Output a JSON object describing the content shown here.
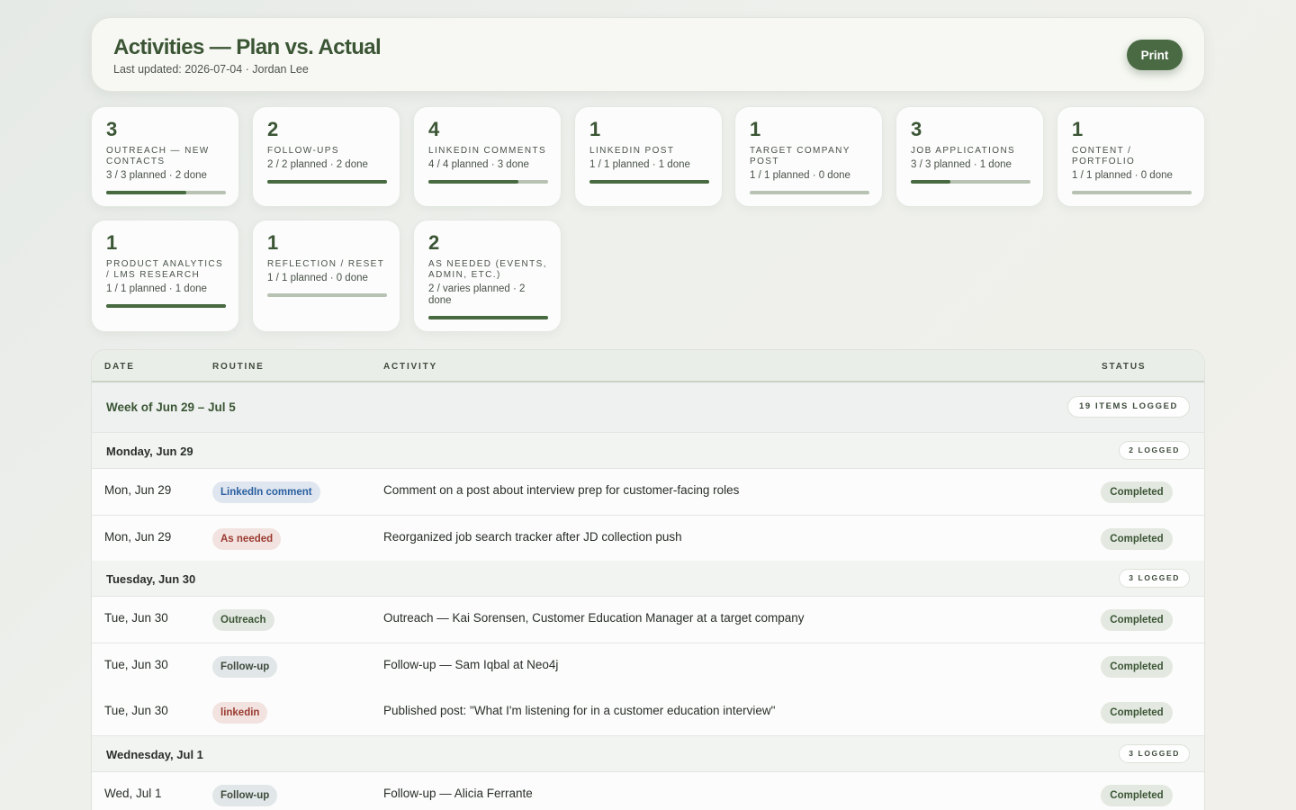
{
  "header": {
    "title": "Activities — Plan vs. Actual",
    "subtitle": "Last updated: 2026-07-04 · Jordan Lee",
    "print_label": "Print"
  },
  "cards": [
    {
      "count": "3",
      "label": "Outreach — new contacts",
      "meta": "3 / 3 planned · 2 done",
      "progress": 0.67
    },
    {
      "count": "2",
      "label": "Follow-ups",
      "meta": "2 / 2 planned · 2 done",
      "progress": 1.0
    },
    {
      "count": "4",
      "label": "LinkedIn comments",
      "meta": "4 / 4 planned · 3 done",
      "progress": 0.75
    },
    {
      "count": "1",
      "label": "LinkedIn post",
      "meta": "1 / 1 planned · 1 done",
      "progress": 1.0
    },
    {
      "count": "1",
      "label": "Target company post",
      "meta": "1 / 1 planned · 0 done",
      "progress": 0.0
    },
    {
      "count": "3",
      "label": "Job applications",
      "meta": "3 / 3 planned · 1 done",
      "progress": 0.33
    },
    {
      "count": "1",
      "label": "Content / portfolio",
      "meta": "1 / 1 planned · 0 done",
      "progress": 0.0
    },
    {
      "count": "1",
      "label": "Product analytics / LMS research",
      "meta": "1 / 1 planned · 1 done",
      "progress": 1.0
    },
    {
      "count": "1",
      "label": "Reflection / reset",
      "meta": "1 / 1 planned · 0 done",
      "progress": 0.0
    },
    {
      "count": "2",
      "label": "As needed (events, admin, etc.)",
      "meta": "2 / varies planned · 2 done",
      "progress": 1.0
    }
  ],
  "table": {
    "columns": {
      "date": "DATE",
      "routine": "ROUTINE",
      "activity": "ACTIVITY",
      "status": "STATUS"
    },
    "week": {
      "title": "Week of Jun 29 – Jul 5",
      "count": "19 ITEMS LOGGED"
    },
    "days": [
      {
        "title": "Monday, Jun 29",
        "count": "2 LOGGED"
      },
      {
        "title": "Tuesday, Jun 30",
        "count": "3 LOGGED"
      },
      {
        "title": "Wednesday, Jul 1",
        "count": "3 LOGGED"
      }
    ],
    "rows": [
      {
        "date": "Mon, Jun 29",
        "routine": "LinkedIn comment",
        "activity": "Comment on a post about interview prep for customer-facing roles",
        "status": "Completed"
      },
      {
        "date": "Mon, Jun 29",
        "routine": "As needed",
        "activity": "Reorganized job search tracker after JD collection push",
        "status": "Completed"
      },
      {
        "date": "Tue, Jun 30",
        "routine": "Outreach",
        "activity": "Outreach — Kai Sorensen, Customer Education Manager at a target company",
        "status": "Completed"
      },
      {
        "date": "Tue, Jun 30",
        "routine": "Follow-up",
        "activity": "Follow-up — Sam Iqbal at Neo4j",
        "status": "Completed"
      },
      {
        "date": "Tue, Jun 30",
        "routine": "linkedin",
        "activity": "Published post: \"What I'm listening for in a customer education interview\"",
        "status": "Completed"
      },
      {
        "date": "Wed, Jul 1",
        "routine": "Follow-up",
        "activity": "Follow-up — Alicia Ferrante",
        "status": "Completed"
      }
    ]
  }
}
